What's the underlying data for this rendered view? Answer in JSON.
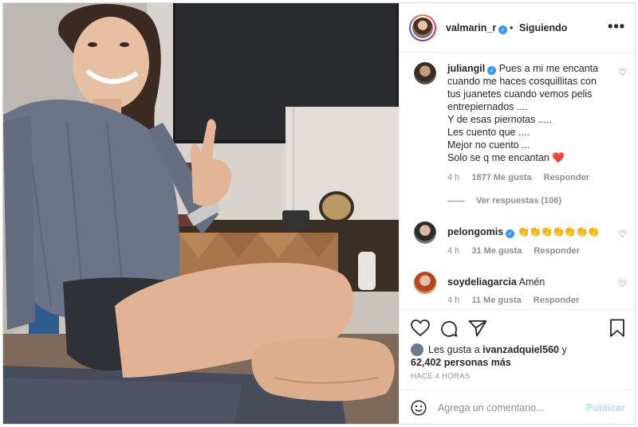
{
  "post": {
    "author": "valmarin_r",
    "author_verified": true,
    "separator": "•",
    "follow_status": "Siguiendo",
    "more_icon": "more-horizontal-icon"
  },
  "comments": [
    {
      "user": "juliangil",
      "verified": true,
      "lines": [
        "Pues a mi me encanta",
        "cuando me haces cosquillitas con",
        "tus juanetes cuando vemos pelis",
        "entrepiernados ....",
        "Y de esas piernotas .....",
        "Les cuento que ....",
        "Mejor no cuento ...",
        "Solo se q me encantan"
      ],
      "emoji": "❤️",
      "time": "4 h",
      "likes": "1877 Me gusta",
      "reply": "Responder",
      "view_replies": "Ver respuestas (106)"
    },
    {
      "user": "pelongomis",
      "verified": true,
      "text": "👏👏👏👏👏👏👏",
      "time": "4 h",
      "likes": "31 Me gusta",
      "reply": "Responder"
    },
    {
      "user": "soydeliagarcia",
      "verified": false,
      "text": "Amén",
      "time": "4 h",
      "likes": "11 Me gusta",
      "reply": "Responder"
    }
  ],
  "likes_summary": {
    "prefix": "Les gusta a",
    "user": "ivanzadquiel560",
    "conjunction": "y",
    "others": "62,402 personas más"
  },
  "time_ago": "HACE 4 HORAS",
  "comment_box": {
    "placeholder": "Agrega un comentario...",
    "publish_label": "Publicar"
  },
  "colors": {
    "verified": "#3897f0",
    "publish": "#b2dffc",
    "meta_gray": "#8e8e8e",
    "heart": "#ed4956"
  }
}
